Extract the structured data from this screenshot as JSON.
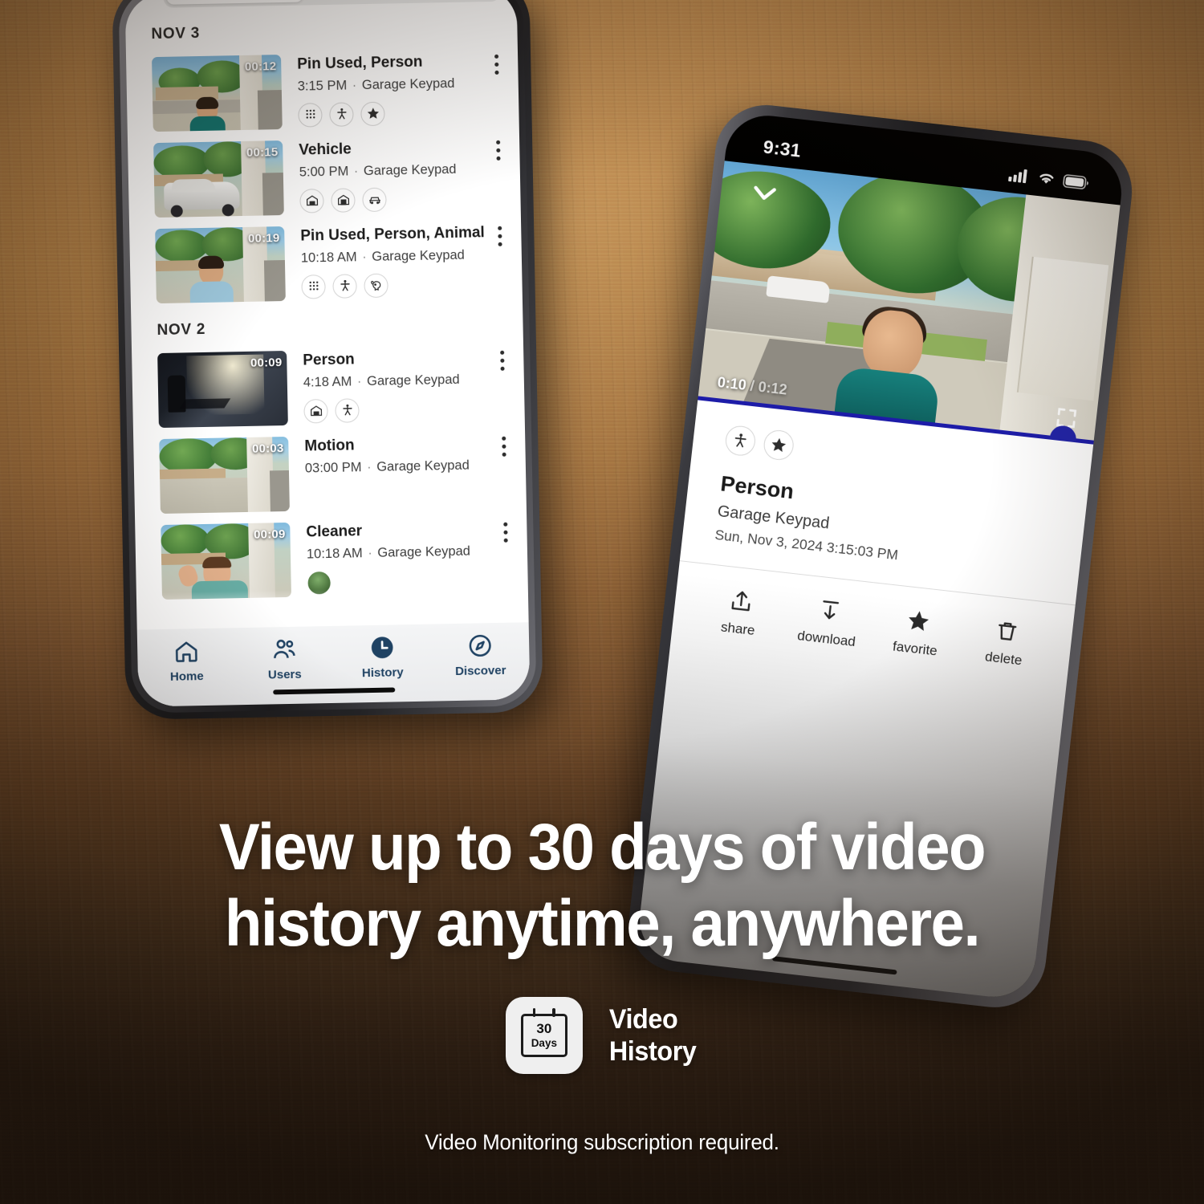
{
  "marketing": {
    "headline_line1": "View up to 30 days of video",
    "headline_line2": "history anytime, anywhere.",
    "badge": {
      "calendar_number": "30",
      "calendar_unit": "Days",
      "title_line1": "Video",
      "title_line2": "History"
    },
    "disclaimer": "Video Monitoring subscription required."
  },
  "history_phone": {
    "groups": [
      {
        "date_label": "NOV 3",
        "events": [
          {
            "duration": "00:12",
            "title": "Pin Used, Person",
            "time": "3:15 PM",
            "separator": "·",
            "camera": "Garage Keypad",
            "chips": [
              "keypad-icon",
              "person-icon",
              "star-icon"
            ]
          },
          {
            "duration": "00:15",
            "title": "Vehicle",
            "time": "5:00 PM",
            "separator": "·",
            "camera": "Garage Keypad",
            "chips": [
              "garage-open-icon",
              "garage-closed-icon",
              "car-icon"
            ]
          },
          {
            "duration": "00:19",
            "title": "Pin Used, Person, Animal",
            "time": "10:18 AM",
            "separator": "·",
            "camera": "Garage Keypad",
            "chips": [
              "keypad-icon",
              "person-icon",
              "animal-icon"
            ]
          }
        ]
      },
      {
        "date_label": "NOV 2",
        "events": [
          {
            "duration": "00:09",
            "title": "Person",
            "time": "4:18 AM",
            "separator": "·",
            "camera": "Garage Keypad",
            "chips": [
              "garage-open-icon",
              "person-icon"
            ]
          },
          {
            "duration": "00:03",
            "title": "Motion",
            "time": "03:00 PM",
            "separator": "·",
            "camera": "Garage Keypad",
            "chips": []
          },
          {
            "duration": "00:09",
            "title": "Cleaner",
            "time": "10:18 AM",
            "separator": "·",
            "camera": "Garage Keypad",
            "chips": [
              "avatar"
            ]
          }
        ]
      }
    ],
    "tabs": [
      {
        "label": "Home",
        "icon": "home-icon",
        "active": false
      },
      {
        "label": "Users",
        "icon": "users-icon",
        "active": false
      },
      {
        "label": "History",
        "icon": "clock-icon",
        "active": true
      },
      {
        "label": "Discover",
        "icon": "compass-icon",
        "active": false
      }
    ]
  },
  "detail_phone": {
    "status_bar": {
      "time": "9:31"
    },
    "player": {
      "elapsed": "0:10",
      "divider": "/",
      "total": "0:12"
    },
    "event": {
      "chips": [
        "person-icon",
        "star-icon"
      ],
      "title": "Person",
      "camera": "Garage Keypad",
      "datetime": "Sun, Nov 3, 2024  3:15:03 PM"
    },
    "actions": [
      {
        "label": "share",
        "icon": "share-icon"
      },
      {
        "label": "download",
        "icon": "download-icon"
      },
      {
        "label": "favorite",
        "icon": "star-icon"
      },
      {
        "label": "delete",
        "icon": "trash-icon"
      }
    ]
  },
  "colors": {
    "accent_navy": "#1f4263",
    "scrubber_blue": "#2224a8",
    "wood": "#a97a43"
  }
}
